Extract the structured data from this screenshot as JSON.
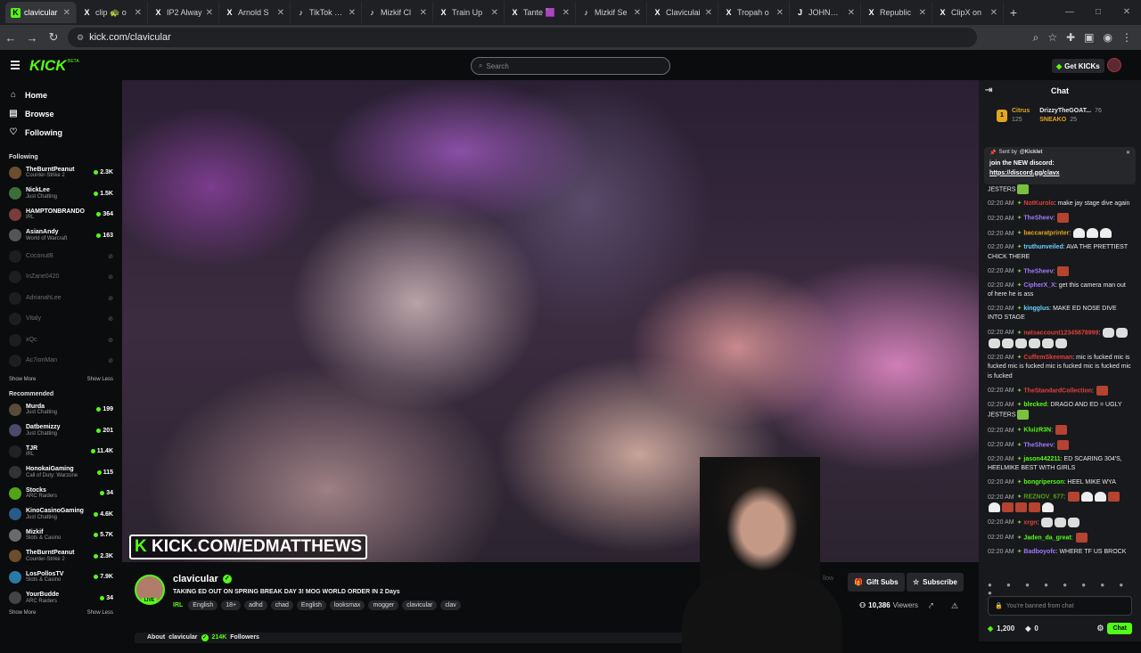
{
  "browser": {
    "tabs": [
      {
        "favicon": "K",
        "favcolor": "#53fc18",
        "title": "clavicular",
        "active": true
      },
      {
        "favicon": "X",
        "favcolor": "#ffffff",
        "title": "clip 🐢 o"
      },
      {
        "favicon": "X",
        "favcolor": "#ffffff",
        "title": "IP2 Alway"
      },
      {
        "favicon": "X",
        "favcolor": "#ffffff",
        "title": "Arnold S"
      },
      {
        "favicon": "♪",
        "favcolor": "#ffffff",
        "title": "TikTok - M"
      },
      {
        "favicon": "♪",
        "favcolor": "#ffffff",
        "title": "Mizkif Cl"
      },
      {
        "favicon": "X",
        "favcolor": "#ffffff",
        "title": "Train Up"
      },
      {
        "favicon": "X",
        "favcolor": "#ffffff",
        "title": "Tante 🟪"
      },
      {
        "favicon": "♪",
        "favcolor": "#ffffff",
        "title": "Mizkif Se"
      },
      {
        "favicon": "X",
        "favcolor": "#ffffff",
        "title": "Claviculai"
      },
      {
        "favicon": "X",
        "favcolor": "#ffffff",
        "title": "Tropah o"
      },
      {
        "favicon": "J",
        "favcolor": "#ffffff",
        "title": "JOHNNY o"
      },
      {
        "favicon": "X",
        "favcolor": "#ffffff",
        "title": "Republic"
      },
      {
        "favicon": "X",
        "favcolor": "#ffffff",
        "title": "ClipX on"
      }
    ],
    "new_tab": "+",
    "url": "kick.com/clavicular"
  },
  "header": {
    "logo": "KICK",
    "beta": "BETA",
    "search_placeholder": "Search",
    "get_kicks": "Get KICKs"
  },
  "sidebar": {
    "nav": [
      {
        "icon": "⌂",
        "label": "Home"
      },
      {
        "icon": "▤",
        "label": "Browse"
      },
      {
        "icon": "♡",
        "label": "Following"
      }
    ],
    "following_label": "Following",
    "following": [
      {
        "name": "TheBurntPeanut",
        "category": "Counter-Strike 2",
        "viewers": "2.3K",
        "avatar_color": "#6b4e2e"
      },
      {
        "name": "NickLee",
        "category": "Just Chatting",
        "viewers": "1.5K",
        "avatar_color": "#3a6e3a"
      },
      {
        "name": "HAMPTONBRANDO",
        "category": "IRL",
        "viewers": "364",
        "avatar_color": "#7a3b3b"
      },
      {
        "name": "AsianAndy",
        "category": "World of Warcraft",
        "viewers": "163",
        "avatar_color": "#555"
      }
    ],
    "offline": [
      "CoconutB",
      "InZane0420",
      "AdrianahLee",
      "Vitaly",
      "xQc",
      "Ac7ionMan"
    ],
    "show_more": "Show More",
    "show_less": "Show Less",
    "recommended_label": "Recommended",
    "recommended": [
      {
        "name": "Murda",
        "category": "Just Chatting",
        "viewers": "199",
        "avatar_color": "#5a4a3a"
      },
      {
        "name": "Datbemizzy",
        "category": "Just Chatting",
        "viewers": "201",
        "avatar_color": "#4a4a6a"
      },
      {
        "name": "TJR",
        "category": "IRL",
        "viewers": "11.4K",
        "avatar_color": "#222"
      },
      {
        "name": "HonokaiGaming",
        "category": "Call of Duty: Warzone",
        "viewers": "115",
        "avatar_color": "#333"
      },
      {
        "name": "Stocks",
        "category": "ARC Raiders",
        "viewers": "34",
        "avatar_color": "#53a318"
      },
      {
        "name": "KinoCasinoGaming",
        "category": "Just Chatting",
        "viewers": "4.6K",
        "avatar_color": "#2a5a8a"
      },
      {
        "name": "Mizkif",
        "category": "Slots & Casino",
        "viewers": "5.7K",
        "avatar_color": "#6a6a6a"
      },
      {
        "name": "TheBurntPeanut",
        "category": "Counter-Strike 2",
        "viewers": "2.3K",
        "avatar_color": "#6b4e2e"
      },
      {
        "name": "LosPollosTV",
        "category": "Slots & Casino",
        "viewers": "7.9K",
        "avatar_color": "#2a7aa8"
      },
      {
        "name": "YourBudde",
        "category": "ARC Raiders",
        "viewers": "34",
        "avatar_color": "#444"
      }
    ]
  },
  "video": {
    "watermark_prefix": "K",
    "watermark": "KICK.COM/EDMATTHEWS"
  },
  "channel": {
    "name": "clavicular",
    "live_tag": "LIVE",
    "title": "TAKING ED OUT ON SPRING BREAK DAY 3! MOG WORLD ORDER IN 2 Days",
    "category": "IRL",
    "tags": [
      "English",
      "18+",
      "adhd",
      "chad",
      "English",
      "looksmax",
      "mogger",
      "clavicular",
      "clav"
    ],
    "follow_ghost": "llow",
    "gift_subs": "Gift Subs",
    "subscribe": "Subscribe",
    "viewers": "10,386",
    "viewers_label": "Viewers",
    "about_prefix": "About",
    "about_name": "clavicular",
    "followers": "214K",
    "followers_label": "Followers"
  },
  "chat": {
    "title": "Chat",
    "gifters": [
      {
        "name": "Citrus",
        "count": "125",
        "color": "#e0a722"
      },
      {
        "name": "DrizzyTheGOAT...",
        "count": "76",
        "color": "#ffffff"
      },
      {
        "name": "SNEAKO",
        "count": "25",
        "color": "#e0a722"
      }
    ],
    "pinned": {
      "sent_by": "Sent by",
      "sender": "@Kicklet",
      "message": "join the NEW discord:",
      "link": "https://discord.gg/clavx"
    },
    "messages": [
      {
        "time": "",
        "user": "",
        "color": "#e8e8e8",
        "text": "JESTERS",
        "emotes": [
          "green"
        ]
      },
      {
        "time": "02:20 AM",
        "user": "NotKurolo",
        "color": "#e0403a",
        "text": "make jay stage dive again",
        "emotes": []
      },
      {
        "time": "02:20 AM",
        "user": "TheSheev",
        "color": "#a178ff",
        "text": "",
        "emotes": [
          "red"
        ]
      },
      {
        "time": "02:20 AM",
        "user": "baccaratprinter",
        "color": "#e0a722",
        "text": "",
        "emotes": [
          "ghost",
          "ghost",
          "ghost"
        ]
      },
      {
        "time": "02:20 AM",
        "user": "truthunveiled",
        "color": "#6ad0ff",
        "text": "AVA THE PRETTIEST CHICK THERE",
        "emotes": []
      },
      {
        "time": "02:20 AM",
        "user": "TheSheev",
        "color": "#a178ff",
        "text": "",
        "emotes": [
          "red"
        ]
      },
      {
        "time": "02:20 AM",
        "user": "CipherX_X",
        "color": "#a178ff",
        "text": "get this camera man out of here he is ass",
        "emotes": []
      },
      {
        "time": "02:20 AM",
        "user": "kingglus",
        "color": "#6ad0ff",
        "text": "MAKE ED NOSE DIVE INTO STAGE",
        "emotes": []
      },
      {
        "time": "02:20 AM",
        "user": "natsaccount12345678999",
        "color": "#e0403a",
        "text": "",
        "emotes": [
          "skull",
          "skull",
          "skull",
          "skull",
          "skull",
          "skull",
          "skull",
          "skull"
        ]
      },
      {
        "time": "02:20 AM",
        "user": "CuffemSkeeman",
        "color": "#e0403a",
        "text": "mic is fucked mic is fucked mic is fucked mic is fucked mic is fucked mic is fucked",
        "emotes": []
      },
      {
        "time": "02:20 AM",
        "user": "TheStandardCollection",
        "color": "#e0403a",
        "text": "",
        "emotes": [
          "red"
        ]
      },
      {
        "time": "02:20 AM",
        "user": "blecked",
        "color": "#53fc18",
        "text": "DRAGO AND ED = UGLY JESTERS",
        "emotes": [
          "green"
        ]
      },
      {
        "time": "02:20 AM",
        "user": "KluizR3N",
        "color": "#53fc18",
        "text": "",
        "emotes": [
          "red"
        ]
      },
      {
        "time": "02:20 AM",
        "user": "TheSheev",
        "color": "#a178ff",
        "text": "",
        "emotes": [
          "red"
        ]
      },
      {
        "time": "02:20 AM",
        "user": "jason442211",
        "color": "#53fc18",
        "text": "ED SCARING 304'S, HEELMIKE BEST WITH GIRLS",
        "emotes": []
      },
      {
        "time": "02:20 AM",
        "user": "bongriperson",
        "color": "#53fc18",
        "text": "HEEL MIKE WYA",
        "emotes": []
      },
      {
        "time": "02:20 AM",
        "user": "REZNOV_677",
        "color": "#53a318",
        "text": "",
        "emotes": [
          "red",
          "ghost",
          "ghost",
          "red",
          "ghost",
          "red",
          "red",
          "red",
          "ghost"
        ]
      },
      {
        "time": "02:20 AM",
        "user": "xrgn",
        "color": "#e0403a",
        "text": "",
        "emotes": [
          "skull",
          "skull",
          "skull"
        ]
      },
      {
        "time": "02:20 AM",
        "user": "Jaden_da_great",
        "color": "#53fc18",
        "text": "",
        "emotes": [
          "red"
        ]
      },
      {
        "time": "02:20 AM",
        "user": "Badboyofc",
        "color": "#a178ff",
        "text": "WHERE TF US BROCK",
        "emotes": []
      }
    ],
    "emote_bar": "● ● ● ● ● ● ● ● ●",
    "input_placeholder": "You're banned from chat",
    "points": "1,200",
    "zero": "0",
    "chat_button": "Chat"
  }
}
